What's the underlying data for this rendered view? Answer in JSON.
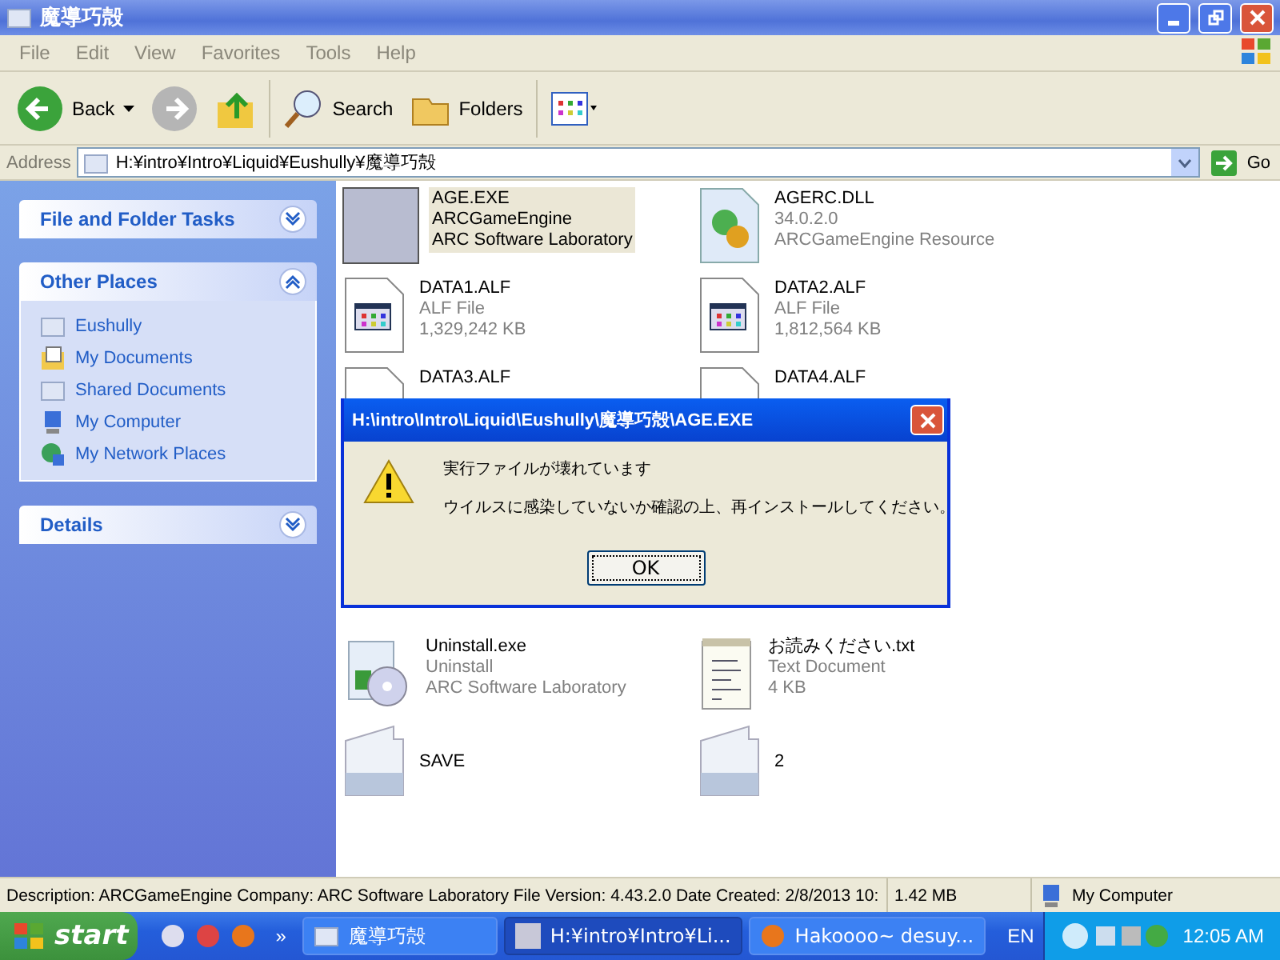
{
  "window": {
    "title": "魔導巧殻"
  },
  "menu": [
    "File",
    "Edit",
    "View",
    "Favorites",
    "Tools",
    "Help"
  ],
  "toolbar": [
    {
      "kind": "back",
      "label": "Back"
    },
    {
      "kind": "forward"
    },
    {
      "kind": "up"
    },
    {
      "kind": "search",
      "label": "Search"
    },
    {
      "kind": "folders",
      "label": "Folders"
    },
    {
      "kind": "views"
    }
  ],
  "address": {
    "label": "Address",
    "value": "H:¥intro¥Intro¥Liquid¥Eushully¥魔導巧殻",
    "go": "Go"
  },
  "panels": [
    {
      "title": "File and Folder Tasks",
      "expanded": false
    },
    {
      "title": "Other Places",
      "expanded": true,
      "items": [
        {
          "label": "Eushully",
          "kind": "folder"
        },
        {
          "label": "My Documents",
          "kind": "documents"
        },
        {
          "label": "Shared Documents",
          "kind": "folder"
        },
        {
          "label": "My Computer",
          "kind": "computer"
        },
        {
          "label": "My Network Places",
          "kind": "network"
        }
      ]
    },
    {
      "title": "Details",
      "expanded": false
    }
  ],
  "files": [
    {
      "name": "AGE.EXE",
      "lines": [
        "ARCGameEngine",
        "ARC Software Laboratory"
      ],
      "kind": "picture",
      "selected": true
    },
    {
      "name": "AGERC.DLL",
      "lines": [
        "34.0.2.0",
        "ARCGameEngine Resource"
      ],
      "kind": "dll",
      "selected": false
    },
    {
      "name": "DATA1.ALF",
      "lines": [
        "ALF File",
        "1,329,242 KB"
      ],
      "kind": "alf",
      "selected": false
    },
    {
      "name": "DATA2.ALF",
      "lines": [
        "ALF File",
        "1,812,564 KB"
      ],
      "kind": "alf",
      "selected": false
    },
    {
      "name": "DATA3.ALF",
      "kind": "alf",
      "selected": false
    },
    {
      "name": "DATA4.ALF",
      "kind": "alf",
      "selected": false
    },
    {
      "name": "Uninstall.exe",
      "lines": [
        "Uninstall",
        "ARC Software Laboratory"
      ],
      "kind": "installer",
      "selected": false
    },
    {
      "name": "お読みください.txt",
      "lines": [
        "Text Document",
        "4 KB"
      ],
      "kind": "text",
      "selected": false
    },
    {
      "name": "SAVE",
      "kind": "folder",
      "selected": false
    },
    {
      "name": "2",
      "kind": "folder",
      "selected": false
    }
  ],
  "dialog": {
    "title": "H:\\intro\\Intro\\Liquid\\Eushully\\魔導巧殻\\AGE.EXE",
    "messages": [
      "実行ファイルが壊れています",
      "ウイルスに感染していないか確認の上、再インストールしてください。"
    ],
    "button": "OK"
  },
  "status_bar": {
    "description": "Description: ARCGameEngine Company: ARC Software Laboratory File Version: 4.43.2.0 Date Created: 2/8/2013 10:",
    "size": "1.42 MB",
    "zone": "My Computer"
  },
  "taskbar": {
    "start": "start",
    "more": "»",
    "tasks": [
      {
        "label": "魔導巧殻",
        "kind": "folder",
        "selected": false
      },
      {
        "label": "H:¥intro¥Intro¥Li...",
        "kind": "picture",
        "selected": true
      },
      {
        "label": "Hakoooo~ desuy...",
        "kind": "browser",
        "selected": false
      }
    ],
    "language": "EN",
    "clock": "12:05 AM"
  }
}
